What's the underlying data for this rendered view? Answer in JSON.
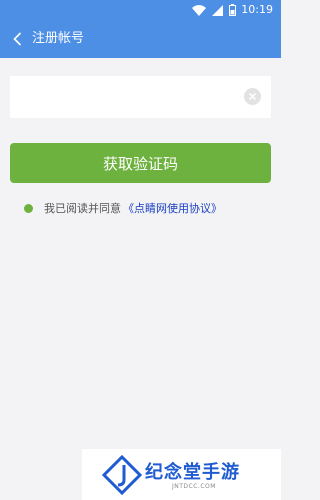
{
  "status_bar": {
    "time": "10:19"
  },
  "header": {
    "title": "注册帐号"
  },
  "form": {
    "phone_value": "",
    "phone_placeholder": "",
    "get_code_label": "获取验证码"
  },
  "agreement": {
    "text": "我已阅读并同意",
    "link": "《点睛网使用协议》",
    "checked": true
  },
  "watermark": {
    "brand": "纪念堂手游",
    "url": "JNTDCC.COM"
  },
  "colors": {
    "header": "#4e8fe6",
    "button": "#6db23f",
    "link": "#1a3fc2",
    "background": "#f3f3f6"
  }
}
